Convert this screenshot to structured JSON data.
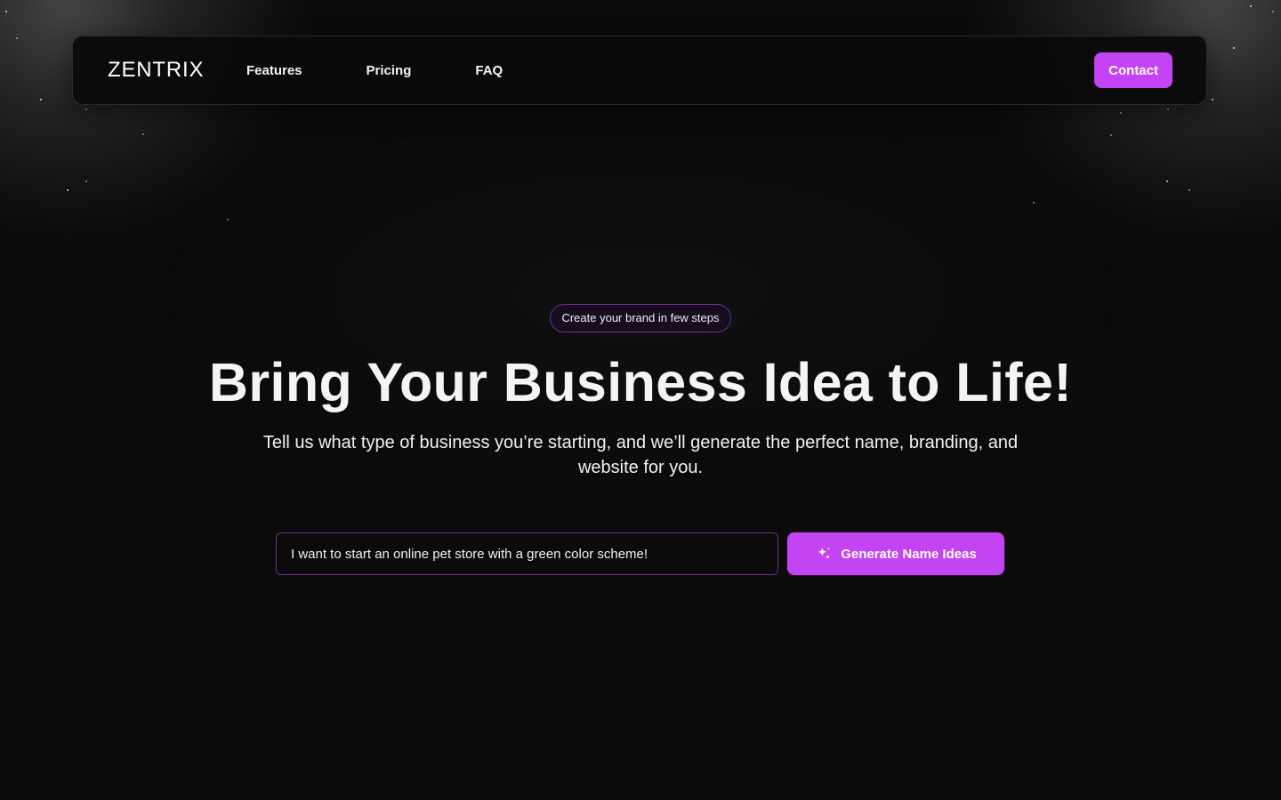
{
  "brand": {
    "name": "ZENTRIX"
  },
  "navbar": {
    "links": [
      {
        "label": "Features"
      },
      {
        "label": "Pricing"
      },
      {
        "label": "FAQ"
      }
    ],
    "contact_label": "Contact"
  },
  "hero": {
    "badge": "Create your brand in few steps",
    "title": "Bring Your Business Idea to Life!",
    "subtitle": "Tell us what type of business you’re starting, and we’ll generate the perfect name, branding, and website for you."
  },
  "prompt": {
    "value": "I want to start an online pet store with a green color scheme!",
    "button_label": "Generate Name Ideas",
    "button_icon": "sparkles-icon"
  },
  "colors": {
    "background": "#0b0b0c",
    "accent": "#c443f2",
    "border": "#2a2a2e",
    "input_border": "#6e2d93"
  }
}
